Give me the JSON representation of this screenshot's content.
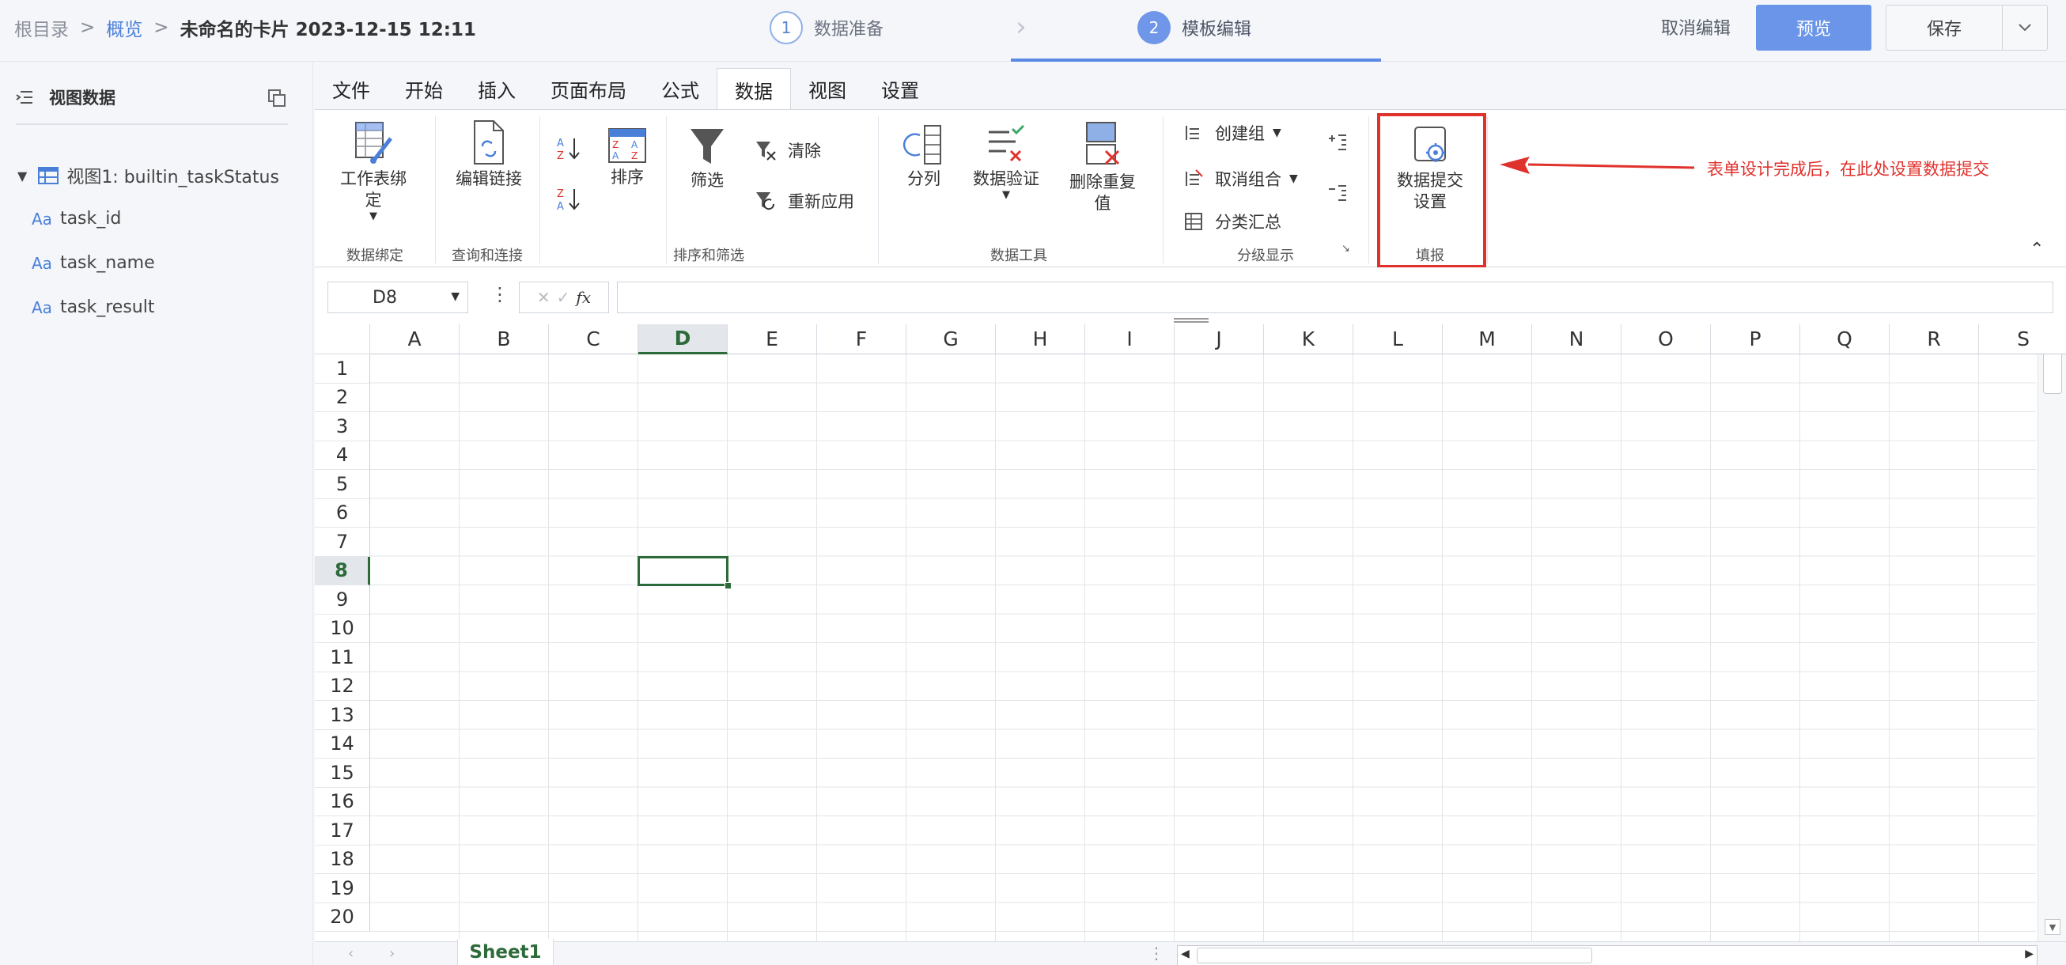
{
  "breadcrumb": {
    "root": "根目录",
    "sep": ">",
    "overview": "概览",
    "current": "未命名的卡片 2023-12-15 12:11"
  },
  "steps": [
    {
      "num": "1",
      "label": "数据准备"
    },
    {
      "num": "2",
      "label": "模板编辑"
    }
  ],
  "header_actions": {
    "cancel": "取消编辑",
    "preview": "预览",
    "save": "保存"
  },
  "sidebar": {
    "title": "视图数据",
    "view": "视图1: builtin_taskStatus",
    "field_prefix": "Aa",
    "fields": [
      "task_id",
      "task_name",
      "task_result"
    ]
  },
  "ribbon": {
    "tabs": [
      "文件",
      "开始",
      "插入",
      "页面布局",
      "公式",
      "数据",
      "视图",
      "设置"
    ],
    "active_tab": "数据",
    "buttons": {
      "bind_sheet_l1": "工作表绑",
      "bind_sheet_l2": "定",
      "edit_links": "编辑链接",
      "sort": "排序",
      "filter": "筛选",
      "clear": "清除",
      "reapply": "重新应用",
      "split": "分列",
      "validation": "数据验证",
      "dedupe_l1": "删除重复",
      "dedupe_l2": "值",
      "create_group": "创建组",
      "ungroup": "取消组合",
      "subtotal": "分类汇总",
      "submit_l1": "数据提交",
      "submit_l2": "设置"
    },
    "groups": {
      "binding": "数据绑定",
      "query": "查询和连接",
      "sort_filter": "排序和筛选",
      "tools": "数据工具",
      "outline": "分级显示",
      "fill": "填报"
    }
  },
  "annotation": {
    "text": "表单设计完成后，在此处设置数据提交",
    "color": "#e0322d"
  },
  "formula_bar": {
    "cell_ref": "D8",
    "fx": "fx",
    "cancel_glyph": "✕",
    "ok_glyph": "✓"
  },
  "grid": {
    "columns": [
      "A",
      "B",
      "C",
      "D",
      "E",
      "F",
      "G",
      "H",
      "I",
      "J",
      "K",
      "L",
      "M",
      "N",
      "O",
      "P",
      "Q",
      "R",
      "S"
    ],
    "rows": [
      "1",
      "2",
      "3",
      "4",
      "5",
      "6",
      "7",
      "8",
      "9",
      "10",
      "11",
      "12",
      "13",
      "14",
      "15",
      "16",
      "17",
      "18",
      "19",
      "20"
    ],
    "selected_col": "D",
    "selected_row": "8"
  },
  "sheets": [
    "Sheet1"
  ],
  "colors": {
    "accent": "#6b95e9",
    "sheet_green": "#2d6a3a",
    "link": "#4a7fd9"
  }
}
